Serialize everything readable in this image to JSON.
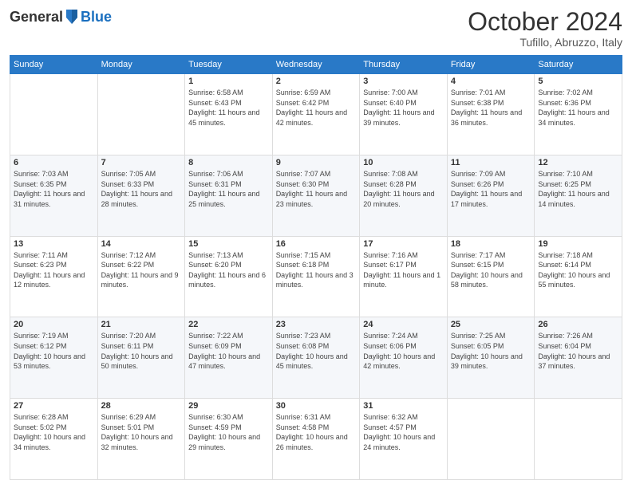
{
  "header": {
    "logo_general": "General",
    "logo_blue": "Blue",
    "title": "October 2024",
    "location": "Tufillo, Abruzzo, Italy"
  },
  "weekdays": [
    "Sunday",
    "Monday",
    "Tuesday",
    "Wednesday",
    "Thursday",
    "Friday",
    "Saturday"
  ],
  "weeks": [
    [
      {
        "day": "",
        "info": ""
      },
      {
        "day": "",
        "info": ""
      },
      {
        "day": "1",
        "info": "Sunrise: 6:58 AM\nSunset: 6:43 PM\nDaylight: 11 hours and 45 minutes."
      },
      {
        "day": "2",
        "info": "Sunrise: 6:59 AM\nSunset: 6:42 PM\nDaylight: 11 hours and 42 minutes."
      },
      {
        "day": "3",
        "info": "Sunrise: 7:00 AM\nSunset: 6:40 PM\nDaylight: 11 hours and 39 minutes."
      },
      {
        "day": "4",
        "info": "Sunrise: 7:01 AM\nSunset: 6:38 PM\nDaylight: 11 hours and 36 minutes."
      },
      {
        "day": "5",
        "info": "Sunrise: 7:02 AM\nSunset: 6:36 PM\nDaylight: 11 hours and 34 minutes."
      }
    ],
    [
      {
        "day": "6",
        "info": "Sunrise: 7:03 AM\nSunset: 6:35 PM\nDaylight: 11 hours and 31 minutes."
      },
      {
        "day": "7",
        "info": "Sunrise: 7:05 AM\nSunset: 6:33 PM\nDaylight: 11 hours and 28 minutes."
      },
      {
        "day": "8",
        "info": "Sunrise: 7:06 AM\nSunset: 6:31 PM\nDaylight: 11 hours and 25 minutes."
      },
      {
        "day": "9",
        "info": "Sunrise: 7:07 AM\nSunset: 6:30 PM\nDaylight: 11 hours and 23 minutes."
      },
      {
        "day": "10",
        "info": "Sunrise: 7:08 AM\nSunset: 6:28 PM\nDaylight: 11 hours and 20 minutes."
      },
      {
        "day": "11",
        "info": "Sunrise: 7:09 AM\nSunset: 6:26 PM\nDaylight: 11 hours and 17 minutes."
      },
      {
        "day": "12",
        "info": "Sunrise: 7:10 AM\nSunset: 6:25 PM\nDaylight: 11 hours and 14 minutes."
      }
    ],
    [
      {
        "day": "13",
        "info": "Sunrise: 7:11 AM\nSunset: 6:23 PM\nDaylight: 11 hours and 12 minutes."
      },
      {
        "day": "14",
        "info": "Sunrise: 7:12 AM\nSunset: 6:22 PM\nDaylight: 11 hours and 9 minutes."
      },
      {
        "day": "15",
        "info": "Sunrise: 7:13 AM\nSunset: 6:20 PM\nDaylight: 11 hours and 6 minutes."
      },
      {
        "day": "16",
        "info": "Sunrise: 7:15 AM\nSunset: 6:18 PM\nDaylight: 11 hours and 3 minutes."
      },
      {
        "day": "17",
        "info": "Sunrise: 7:16 AM\nSunset: 6:17 PM\nDaylight: 11 hours and 1 minute."
      },
      {
        "day": "18",
        "info": "Sunrise: 7:17 AM\nSunset: 6:15 PM\nDaylight: 10 hours and 58 minutes."
      },
      {
        "day": "19",
        "info": "Sunrise: 7:18 AM\nSunset: 6:14 PM\nDaylight: 10 hours and 55 minutes."
      }
    ],
    [
      {
        "day": "20",
        "info": "Sunrise: 7:19 AM\nSunset: 6:12 PM\nDaylight: 10 hours and 53 minutes."
      },
      {
        "day": "21",
        "info": "Sunrise: 7:20 AM\nSunset: 6:11 PM\nDaylight: 10 hours and 50 minutes."
      },
      {
        "day": "22",
        "info": "Sunrise: 7:22 AM\nSunset: 6:09 PM\nDaylight: 10 hours and 47 minutes."
      },
      {
        "day": "23",
        "info": "Sunrise: 7:23 AM\nSunset: 6:08 PM\nDaylight: 10 hours and 45 minutes."
      },
      {
        "day": "24",
        "info": "Sunrise: 7:24 AM\nSunset: 6:06 PM\nDaylight: 10 hours and 42 minutes."
      },
      {
        "day": "25",
        "info": "Sunrise: 7:25 AM\nSunset: 6:05 PM\nDaylight: 10 hours and 39 minutes."
      },
      {
        "day": "26",
        "info": "Sunrise: 7:26 AM\nSunset: 6:04 PM\nDaylight: 10 hours and 37 minutes."
      }
    ],
    [
      {
        "day": "27",
        "info": "Sunrise: 6:28 AM\nSunset: 5:02 PM\nDaylight: 10 hours and 34 minutes."
      },
      {
        "day": "28",
        "info": "Sunrise: 6:29 AM\nSunset: 5:01 PM\nDaylight: 10 hours and 32 minutes."
      },
      {
        "day": "29",
        "info": "Sunrise: 6:30 AM\nSunset: 4:59 PM\nDaylight: 10 hours and 29 minutes."
      },
      {
        "day": "30",
        "info": "Sunrise: 6:31 AM\nSunset: 4:58 PM\nDaylight: 10 hours and 26 minutes."
      },
      {
        "day": "31",
        "info": "Sunrise: 6:32 AM\nSunset: 4:57 PM\nDaylight: 10 hours and 24 minutes."
      },
      {
        "day": "",
        "info": ""
      },
      {
        "day": "",
        "info": ""
      }
    ]
  ]
}
